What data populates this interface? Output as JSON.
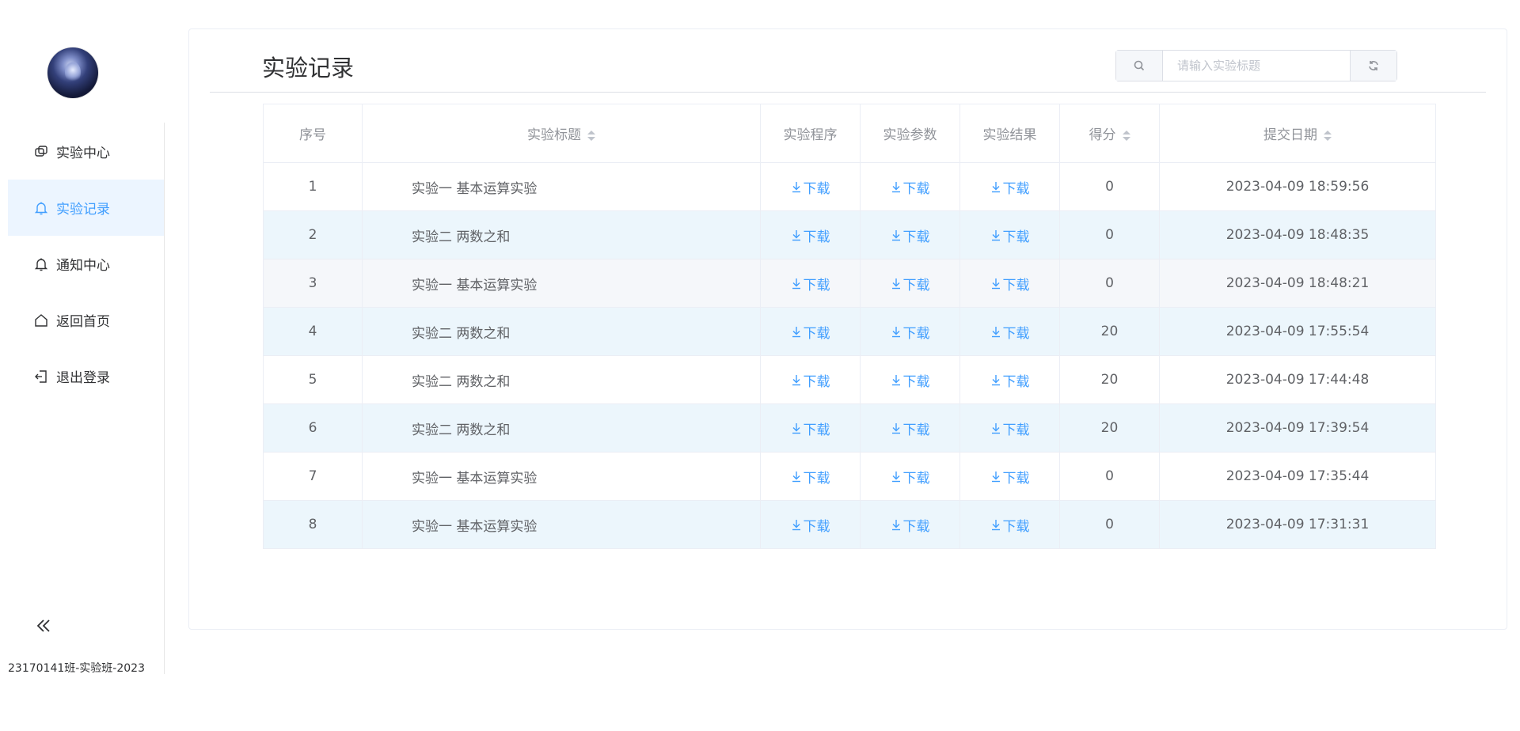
{
  "sidebar": {
    "menu": [
      {
        "label": "实验中心",
        "icon": "experiment-icon"
      },
      {
        "label": "实验记录",
        "icon": "bell-icon",
        "active": true
      },
      {
        "label": "通知中心",
        "icon": "bell-icon"
      },
      {
        "label": "返回首页",
        "icon": "home-icon"
      },
      {
        "label": "退出登录",
        "icon": "logout-icon"
      }
    ],
    "footer": "23170141班-实验班-2023",
    "collapse_icon": "double-chevron-left-icon"
  },
  "main": {
    "title": "实验记录",
    "search": {
      "placeholder": "请输入实验标题",
      "value": ""
    }
  },
  "table": {
    "headers": [
      "序号",
      "实验标题",
      "实验程序",
      "实验参数",
      "实验结果",
      "得分",
      "提交日期"
    ],
    "download_label": "下载",
    "rows": [
      {
        "no": "1",
        "title": "实验一 基本运算实验",
        "score": "0",
        "date": "2023-04-09 18:59:56"
      },
      {
        "no": "2",
        "title": "实验二 两数之和",
        "score": "0",
        "date": "2023-04-09 18:48:35"
      },
      {
        "no": "3",
        "title": "实验一 基本运算实验",
        "score": "0",
        "date": "2023-04-09 18:48:21"
      },
      {
        "no": "4",
        "title": "实验二 两数之和",
        "score": "20",
        "date": "2023-04-09 17:55:54"
      },
      {
        "no": "5",
        "title": "实验二 两数之和",
        "score": "20",
        "date": "2023-04-09 17:44:48"
      },
      {
        "no": "6",
        "title": "实验二 两数之和",
        "score": "20",
        "date": "2023-04-09 17:39:54"
      },
      {
        "no": "7",
        "title": "实验一 基本运算实验",
        "score": "0",
        "date": "2023-04-09 17:35:44"
      },
      {
        "no": "8",
        "title": "实验一 基本运算实验",
        "score": "0",
        "date": "2023-04-09 17:31:31"
      }
    ]
  },
  "colors": {
    "accent": "#409eff",
    "active_bg": "#ecf5ff",
    "striped_row": "#ecf6fc"
  }
}
